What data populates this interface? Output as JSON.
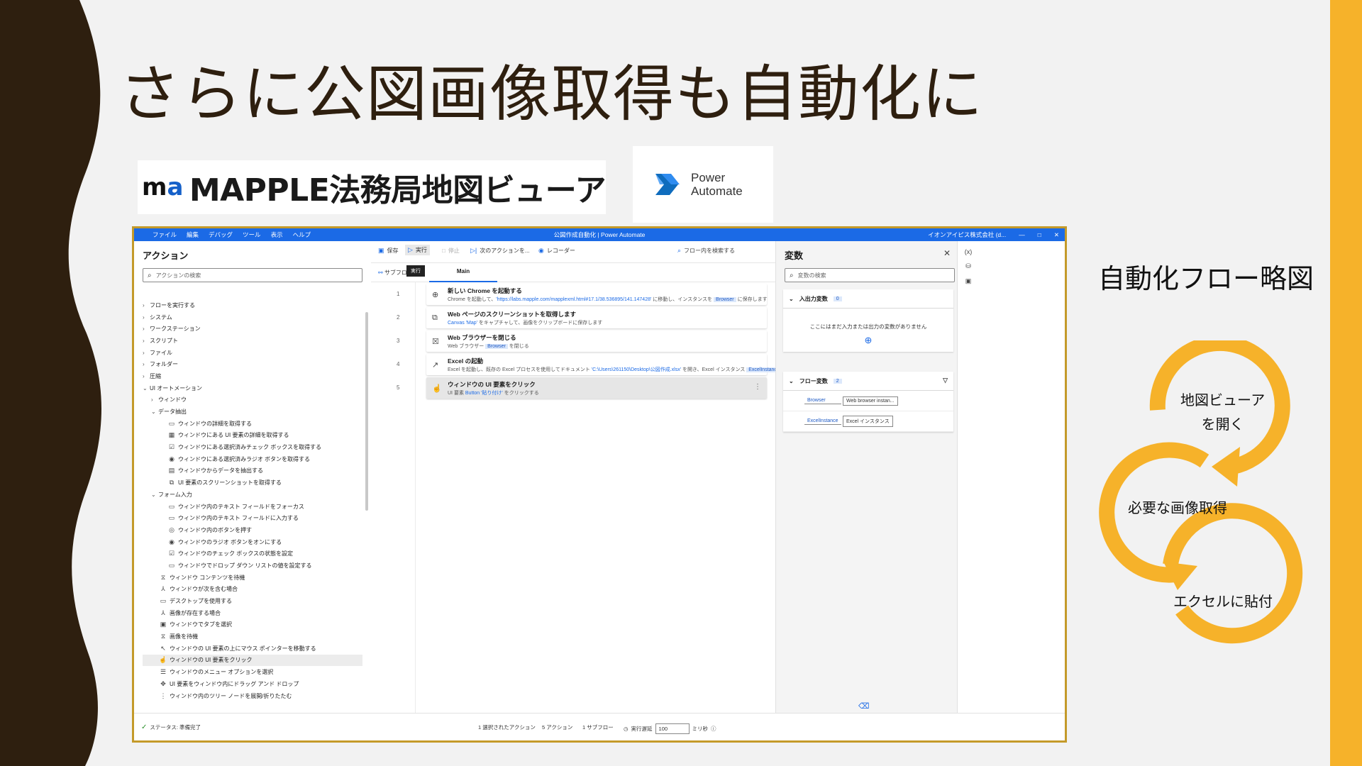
{
  "slide": {
    "title": "さらに公図画像取得も自動化に",
    "accent_color": "#f6b22a",
    "dark_color": "#2e1f0f"
  },
  "logos": {
    "mapple_mark": "m",
    "mapple_mark_accent": "a",
    "mapple_text": "MAPPLE法務局地図ビューア",
    "pa_line1": "Power",
    "pa_line2": "Automate"
  },
  "window": {
    "title": "公図作成自動化 | Power Automate",
    "menu": [
      "ファイル",
      "編集",
      "デバッグ",
      "ツール",
      "表示",
      "ヘルプ"
    ],
    "account": "イオンアイピス株式会社 (d...",
    "minimize": "—",
    "maximize": "□",
    "close": "✕"
  },
  "actions_pane": {
    "title": "アクション",
    "search_placeholder": "アクションの検索",
    "tree": [
      {
        "label": "フローを実行する",
        "level": 0,
        "chev": "›",
        "icon": ""
      },
      {
        "label": "システム",
        "level": 0,
        "chev": "›",
        "icon": ""
      },
      {
        "label": "ワークステーション",
        "level": 0,
        "chev": "›",
        "icon": ""
      },
      {
        "label": "スクリプト",
        "level": 0,
        "chev": "›",
        "icon": ""
      },
      {
        "label": "ファイル",
        "level": 0,
        "chev": "›",
        "icon": ""
      },
      {
        "label": "フォルダー",
        "level": 0,
        "chev": "›",
        "icon": ""
      },
      {
        "label": "圧縮",
        "level": 0,
        "chev": "›",
        "icon": ""
      },
      {
        "label": "UI オートメーション",
        "level": 0,
        "chev": "⌄",
        "icon": ""
      },
      {
        "label": "ウィンドウ",
        "level": 1,
        "chev": "›",
        "icon": ""
      },
      {
        "label": "データ抽出",
        "level": 1,
        "chev": "⌄",
        "icon": ""
      },
      {
        "label": "ウィンドウの詳細を取得する",
        "level": 2,
        "chev": "",
        "icon": "▭"
      },
      {
        "label": "ウィンドウにある UI 要素の詳細を取得する",
        "level": 2,
        "chev": "",
        "icon": "▦"
      },
      {
        "label": "ウィンドウにある選択済みチェック ボックスを取得する",
        "level": 2,
        "chev": "",
        "icon": "☑"
      },
      {
        "label": "ウィンドウにある選択済みラジオ ボタンを取得する",
        "level": 2,
        "chev": "",
        "icon": "◉"
      },
      {
        "label": "ウィンドウからデータを抽出する",
        "level": 2,
        "chev": "",
        "icon": "▤"
      },
      {
        "label": "UI 要素のスクリーンショットを取得する",
        "level": 2,
        "chev": "",
        "icon": "⧉"
      },
      {
        "label": "フォーム入力",
        "level": 1,
        "chev": "⌄",
        "icon": ""
      },
      {
        "label": "ウィンドウ内のテキスト フィールドをフォーカス",
        "level": 2,
        "chev": "",
        "icon": "▭"
      },
      {
        "label": "ウィンドウ内のテキスト フィールドに入力する",
        "level": 2,
        "chev": "",
        "icon": "▭"
      },
      {
        "label": "ウィンドウ内のボタンを押す",
        "level": 2,
        "chev": "",
        "icon": "◎"
      },
      {
        "label": "ウィンドウのラジオ ボタンをオンにする",
        "level": 2,
        "chev": "",
        "icon": "◉"
      },
      {
        "label": "ウィンドウのチェック ボックスの状態を設定",
        "level": 2,
        "chev": "",
        "icon": "☑"
      },
      {
        "label": "ウィンドウでドロップ ダウン リストの値を設定する",
        "level": 2,
        "chev": "",
        "icon": "▭"
      },
      {
        "label": "ウィンドウ コンテンツを待機",
        "level": 1,
        "chev": "",
        "icon": "⧖"
      },
      {
        "label": "ウィンドウが次を含む場合",
        "level": 1,
        "chev": "",
        "icon": "⅄"
      },
      {
        "label": "デスクトップを使用する",
        "level": 1,
        "chev": "",
        "icon": "▭"
      },
      {
        "label": "画像が存在する場合",
        "level": 1,
        "chev": "",
        "icon": "⅄"
      },
      {
        "label": "ウィンドウでタブを選択",
        "level": 1,
        "chev": "",
        "icon": "▣"
      },
      {
        "label": "画像を待機",
        "level": 1,
        "chev": "",
        "icon": "⧖"
      },
      {
        "label": "ウィンドウの UI 要素の上にマウス ポインターを移動する",
        "level": 1,
        "chev": "",
        "icon": "↖"
      },
      {
        "label": "ウィンドウの UI 要素をクリック",
        "level": 1,
        "chev": "",
        "icon": "☝",
        "selected": true
      },
      {
        "label": "ウィンドウのメニュー オプションを選択",
        "level": 1,
        "chev": "",
        "icon": "☰"
      },
      {
        "label": "UI 要素をウィンドウ内にドラッグ アンド ドロップ",
        "level": 1,
        "chev": "",
        "icon": "✥"
      },
      {
        "label": "ウィンドウ内のツリー ノードを展開/折りたたむ",
        "level": 1,
        "chev": "",
        "icon": "⋮"
      }
    ]
  },
  "toolbar": {
    "save": "保存",
    "run": "実行",
    "stop": "停止",
    "next_action": "次のアクションを...",
    "recorder": "レコーダー",
    "search_flow": "フロー内を検索する",
    "tooltip": "実行"
  },
  "tabs": {
    "subflows": "サブフロー",
    "main": "Main"
  },
  "steps": [
    {
      "no": "1",
      "icon": "⊕",
      "title": "新しい Chrome を起動する",
      "desc_pre": "Chrome を起動して、",
      "desc_val": "'https://labs.mapple.com/mapplexml.html#17.1/38.536895/141.147428'",
      "desc_mid": " に移動し、インスタンスを ",
      "desc_chip": "Browser",
      "desc_post": " に保存します"
    },
    {
      "no": "2",
      "icon": "⧉",
      "title": "Web ページのスクリーンショットを取得します",
      "desc_pre": "",
      "desc_val": "Canvas 'Map'",
      "desc_mid": " をキャプチャして、画像をクリップボードに保存します",
      "desc_chip": "",
      "desc_post": ""
    },
    {
      "no": "3",
      "icon": "☒",
      "title": "Web ブラウザーを閉じる",
      "desc_pre": "Web ブラウザー ",
      "desc_val": "",
      "desc_mid": "",
      "desc_chip": "Browser",
      "desc_post": " を閉じる"
    },
    {
      "no": "4",
      "icon": "↗",
      "title": "Excel の起動",
      "desc_pre": "Excel を起動し、既存の Excel プロセスを使用してドキュメント ",
      "desc_val": "'C:\\Users\\261150\\Desktop\\公図作成.xlsx'",
      "desc_mid": " を開き、Excel インスタンス ",
      "desc_chip": "ExcelInstance",
      "desc_post": " に保存します。"
    },
    {
      "no": "5",
      "icon": "☝",
      "title": "ウィンドウの UI 要素をクリック",
      "desc_pre": "UI 要素 ",
      "desc_val": "Button '貼り付け'",
      "desc_mid": " をクリックする",
      "desc_chip": "",
      "desc_post": ""
    }
  ],
  "vars_pane": {
    "title": "変数",
    "search_placeholder": "変数の検索",
    "io_title": "入出力変数",
    "io_count": "0",
    "io_empty": "ここにはまだ入力または出力の変数がありません",
    "flow_title": "フロー変数",
    "flow_count": "2",
    "flow_vars": [
      {
        "name": "Browser",
        "value": "Web browser instan..."
      },
      {
        "name": "ExcelInstance",
        "value": "Excel インスタンス"
      }
    ]
  },
  "side_strip": [
    "(x)",
    "⛁",
    "▣"
  ],
  "statusbar": {
    "status": "ステータス: 準備完了",
    "selected": "1 選択されたアクション",
    "actions": "5 アクション",
    "subflows": "1 サブフロー",
    "delay_label": "実行遅延",
    "delay_value": "100",
    "unit": "ミリ秒"
  },
  "diagram": {
    "title": "自動化フロー略図",
    "steps": [
      "地図ビューア\nを開く",
      "必要な画像取得",
      "エクセルに貼付"
    ],
    "step1_line1": "地図ビューア",
    "step1_line2": "を開く",
    "step2": "必要な画像取得",
    "step3": "エクセルに貼付"
  }
}
